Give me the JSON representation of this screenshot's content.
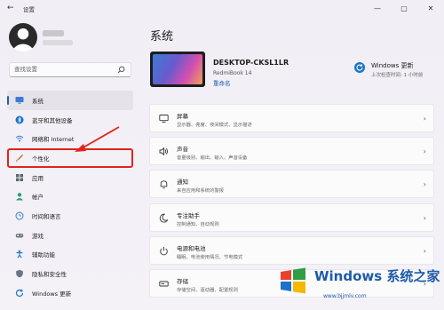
{
  "window": {
    "title": "设置",
    "controls": [
      "—",
      "▢",
      "✕"
    ]
  },
  "sidebar": {
    "search_placeholder": "查找设置",
    "items": [
      {
        "label": "系统",
        "icon": "monitor-icon",
        "active": true
      },
      {
        "label": "蓝牙和其他设备",
        "icon": "bluetooth-icon"
      },
      {
        "label": "网络和 Internet",
        "icon": "network-icon"
      },
      {
        "label": "个性化",
        "icon": "brush-icon",
        "highlight": true
      },
      {
        "label": "应用",
        "icon": "apps-icon"
      },
      {
        "label": "帐户",
        "icon": "account-icon"
      },
      {
        "label": "时间和语言",
        "icon": "globe-clock-icon"
      },
      {
        "label": "游戏",
        "icon": "gamepad-icon"
      },
      {
        "label": "辅助功能",
        "icon": "accessibility-icon"
      },
      {
        "label": "隐私和安全性",
        "icon": "shield-icon"
      },
      {
        "label": "Windows 更新",
        "icon": "windows-update-icon"
      }
    ]
  },
  "main": {
    "title": "系统",
    "device": {
      "name": "DESKTOP-CKSL1LR",
      "model": "RedmiBook 14",
      "rename": "重命名"
    },
    "windows_update": {
      "title": "Windows 更新",
      "subtitle": "上次检查时间: 1 小时前"
    },
    "cards": [
      {
        "title": "屏幕",
        "subtitle": "显示器、亮度、夜间模式、显示描述",
        "icon": "display-icon"
      },
      {
        "title": "声音",
        "subtitle": "音量级别、输出、输入、声音设备",
        "icon": "sound-icon"
      },
      {
        "title": "通知",
        "subtitle": "来自应用和系统的警报",
        "icon": "bell-icon"
      },
      {
        "title": "专注助手",
        "subtitle": "控制通知、自动规则",
        "icon": "moon-icon"
      },
      {
        "title": "电源和电池",
        "subtitle": "睡眠、电池使用情况、节电模式",
        "icon": "power-icon"
      },
      {
        "title": "存储",
        "subtitle": "存储空间、驱动器、配置规则",
        "icon": "storage-icon"
      }
    ]
  },
  "watermark": {
    "text": "Windows 系统之家",
    "url": "www.bjjmlv.com"
  }
}
